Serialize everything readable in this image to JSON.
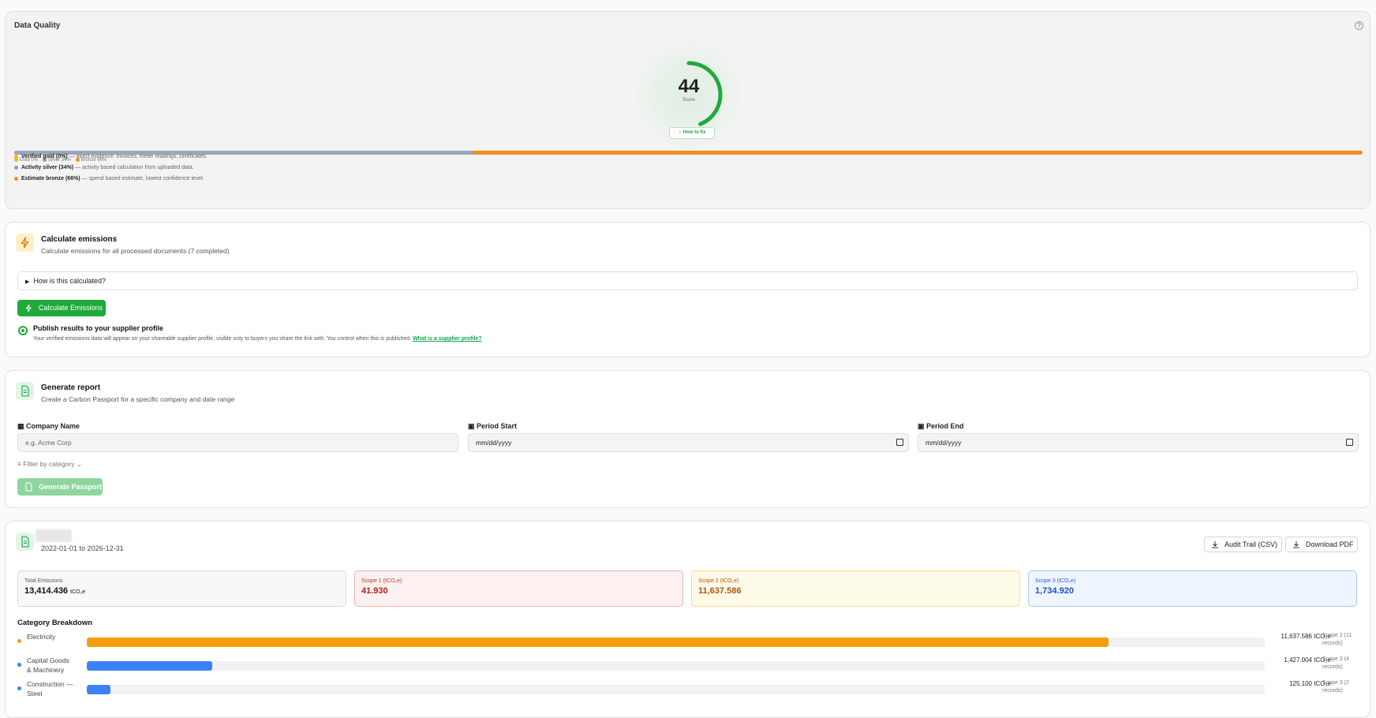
{
  "data_quality": {
    "title": "Data Quality",
    "score": "44",
    "score_label": "Score",
    "score_fraction": 0.44,
    "how_to_fix": "How to fix",
    "silver_fraction": 0.34,
    "legend": [
      {
        "label": "Gold 0%",
        "color": "#f2b705"
      },
      {
        "label": "Silver 34%",
        "color": "#8d9bb5"
      },
      {
        "label": "Bronze 66%",
        "color": "#f18f1c"
      }
    ],
    "tiers": [
      {
        "name": "Verified gold (0%)",
        "desc": " — direct evidence: invoices, meter readings, certificates.",
        "color": "#f2b705"
      },
      {
        "name": "Activity silver (34%)",
        "desc": " — activity based calculation from uploaded data.",
        "color": "#8d9bb5"
      },
      {
        "name": "Estimate bronze (66%)",
        "desc": " — spend based estimate, lowest confidence level.",
        "color": "#f18f1c"
      }
    ]
  },
  "calculate": {
    "title": "Calculate emissions",
    "subtitle": "Calculate emissions for all processed documents (7 completed)",
    "details_label": "How is this calculated?",
    "button": "Calculate Emissions",
    "publish_title": "Publish results to your supplier profile",
    "publish_desc": "Your verified emissions data will appear on your shareable supplier profile, visible only to buyers you share the link with. You control when this is published.",
    "publish_link": "What is a supplier profile?"
  },
  "report": {
    "title": "Generate report",
    "subtitle": "Create a Carbon Passport for a specific company and date range",
    "company_label": "Company Name",
    "company_placeholder": "e.g. Acme Corp",
    "start_label": "Period Start",
    "start_value": "mm/dd/yyyy",
    "end_label": "Period End",
    "end_value": "mm/dd/yyyy",
    "filter": "Filter by category",
    "button": "Generate Passport"
  },
  "results": {
    "period": "2022-01-01 to 2026-12-31",
    "audit_button": "Audit Trail (CSV)",
    "pdf_button": "Download PDF",
    "total_label": "Total Emissions",
    "total_value": "13,414.436",
    "total_unit": "tCO₂e",
    "scope1_label": "Scope 1 (tCO₂e)",
    "scope1_value": "41.930",
    "scope2_label": "Scope 2 (tCO₂e)",
    "scope2_value": "11,637.586",
    "scope3_label": "Scope 3 (tCO₂e)",
    "scope3_value": "1,734.920",
    "breakdown_title": "Category Breakdown",
    "categories": [
      {
        "name": "Electricity",
        "value": "11,637.586 tCO₂e",
        "scope": "Scope 2 (11 records)",
        "fraction": 0.8675,
        "color": "#f59e0b"
      },
      {
        "name": "Capital Goods & Machinery",
        "value": "1,427.004 tCO₂e",
        "scope": "Scope 3 (4 records)",
        "fraction": 0.1064,
        "color": "#3b82f6"
      },
      {
        "name": "Construction — Steel",
        "value": "125.100 tCO₂e",
        "scope": "Scope 3 (2 records)",
        "fraction": 0.0204,
        "color": "#3b82f6"
      }
    ]
  }
}
